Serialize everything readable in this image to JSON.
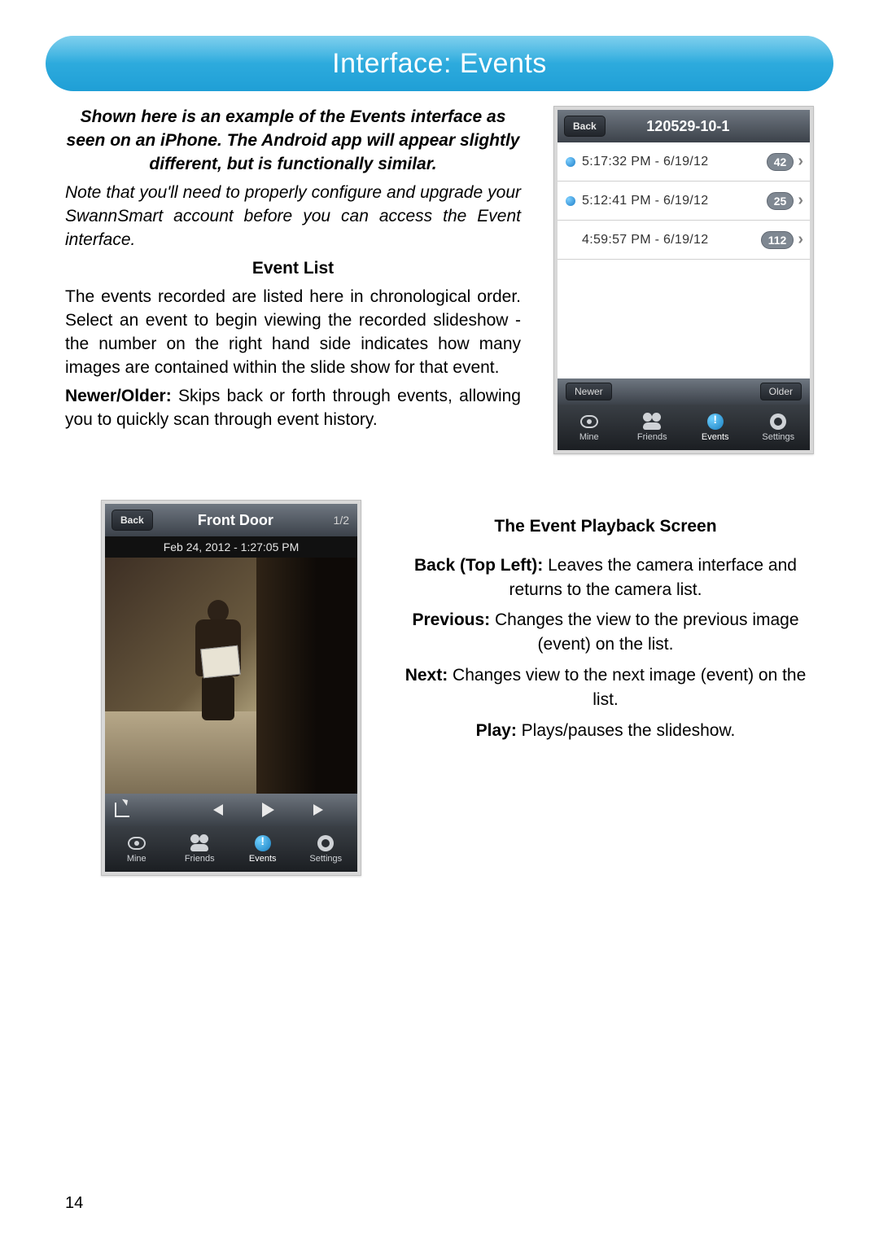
{
  "header": {
    "title": "Interface: Events"
  },
  "intro": {
    "bold": "Shown here is an example of the Events interface as seen on an iPhone. The Android app will appear slightly different, but is functionally similar.",
    "italic": "Note that you'll need to properly configure and upgrade your SwannSmart account before you can access the Event interface."
  },
  "eventList": {
    "title": "Event List",
    "p1": "The events recorded are listed here in chronological order. Select an event to begin viewing the recorded slideshow - the number on the right hand side indicates how many images are contained within the slide show for that event.",
    "newerOlderLabel": "Newer/Older:",
    "p2": " Skips back or forth through events, allowing you to quickly scan through event history."
  },
  "phoneList": {
    "back": "Back",
    "title": "120529-10-1",
    "items": [
      {
        "dot": true,
        "label": "5:17:32 PM - 6/19/12",
        "count": "42"
      },
      {
        "dot": true,
        "label": "5:12:41 PM - 6/19/12",
        "count": "25"
      },
      {
        "dot": false,
        "label": "4:59:57 PM - 6/19/12",
        "count": "112"
      }
    ],
    "newer": "Newer",
    "older": "Older"
  },
  "tabs": {
    "mine": "Mine",
    "friends": "Friends",
    "events": "Events",
    "settings": "Settings"
  },
  "phonePlayback": {
    "back": "Back",
    "title": "Front Door",
    "counter": "1/2",
    "timestamp": "Feb 24, 2012 - 1:27:05 PM"
  },
  "playback": {
    "title": "The Event Playback Screen",
    "backLabel": "Back (Top Left):",
    "backText": " Leaves the camera interface and returns  to the camera list.",
    "prevLabel": "Previous:",
    "prevText": " Changes the view to the previous image (event) on the list.",
    "nextLabel": "Next:",
    "nextText": " Changes view to the next image (event) on the list.",
    "playLabel": "Play:",
    "playText": " Plays/pauses the slideshow."
  },
  "pageNumber": "14"
}
